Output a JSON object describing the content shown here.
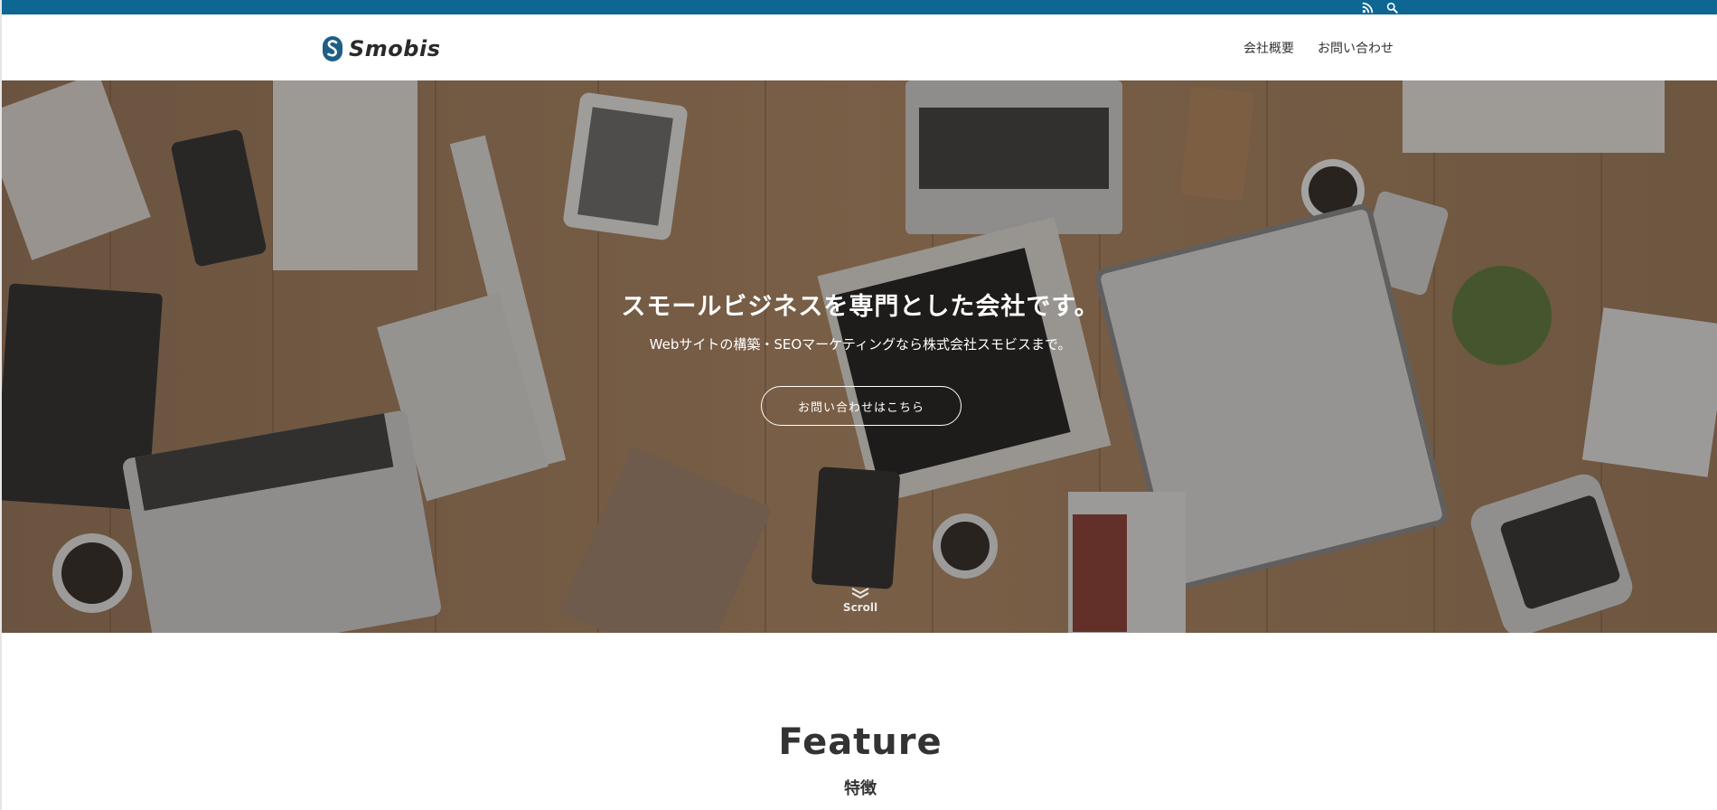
{
  "topbar": {
    "bg_color": "#0e6693",
    "icons": [
      "rss-icon",
      "search-icon"
    ]
  },
  "header": {
    "logo_text": "Smobis",
    "nav": [
      {
        "label": "会社概要"
      },
      {
        "label": "お問い合わせ"
      }
    ]
  },
  "hero": {
    "title": "スモールビジネスを専門とした会社です。",
    "subtitle": "Webサイトの構築・SEOマーケティングなら株式会社スモビスまで。",
    "cta_label": "お問い合わせはこちら",
    "scroll_label": "Scroll"
  },
  "feature": {
    "title": "Feature",
    "subtitle": "特徴"
  },
  "colors": {
    "accent": "#0e6693",
    "text": "#333333",
    "hero_text": "#ffffff"
  }
}
